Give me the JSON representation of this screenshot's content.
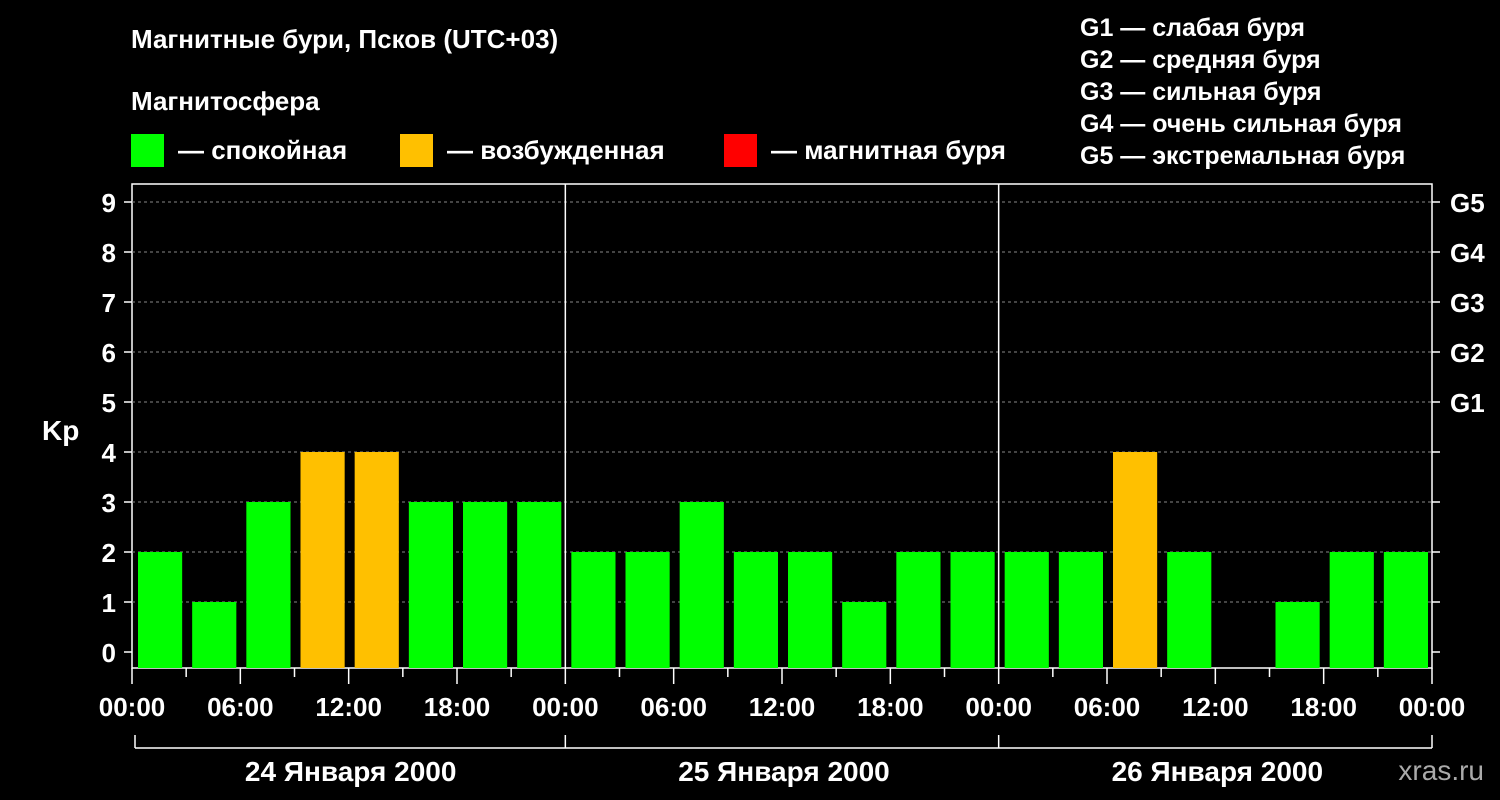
{
  "title": "Магнитные бури, Псков (UTC+03)",
  "subtitle": "Магнитосфера",
  "legend": [
    {
      "label": "— спокойная",
      "color": "#00ff00"
    },
    {
      "label": "— возбужденная",
      "color": "#ffc000"
    },
    {
      "label": "— магнитная буря",
      "color": "#ff0000"
    }
  ],
  "g_scale": [
    "G1 — слабая буря",
    "G2 — средняя буря",
    "G3 — сильная буря",
    "G4 — очень сильная буря",
    "G5 — экстремальная буря"
  ],
  "watermark": "xras.ru",
  "chart_data": {
    "type": "bar",
    "ylabel": "Kp",
    "ylim": [
      0,
      9
    ],
    "y_ticks": [
      "0",
      "1",
      "2",
      "3",
      "4",
      "5",
      "6",
      "7",
      "8",
      "9"
    ],
    "right_ticks": [
      {
        "kp": 5,
        "label": "G1"
      },
      {
        "kp": 6,
        "label": "G2"
      },
      {
        "kp": 7,
        "label": "G3"
      },
      {
        "kp": 8,
        "label": "G4"
      },
      {
        "kp": 9,
        "label": "G5"
      }
    ],
    "x_tick_labels": [
      "00:00",
      "06:00",
      "12:00",
      "18:00",
      "00:00",
      "06:00",
      "12:00",
      "18:00",
      "00:00",
      "06:00",
      "12:00",
      "18:00",
      "00:00"
    ],
    "days": [
      "24 Января 2000",
      "25 Января 2000",
      "26 Января 2000"
    ],
    "grid": true,
    "values": [
      2,
      1,
      3,
      4,
      4,
      3,
      3,
      3,
      2,
      2,
      3,
      2,
      2,
      1,
      2,
      2,
      2,
      2,
      4,
      2,
      0,
      1,
      2,
      2
    ],
    "colors": {
      "quiet": "#00ff00",
      "active": "#ffc000",
      "storm": "#ff0000"
    }
  }
}
